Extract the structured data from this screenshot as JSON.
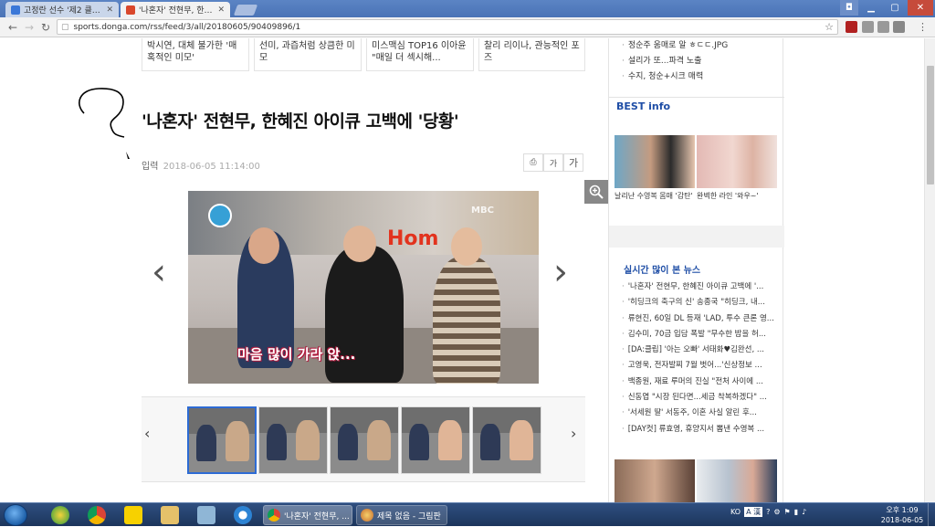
{
  "browser": {
    "tabs": [
      {
        "title": "고정란 선수 '제2 클라이",
        "active": false
      },
      {
        "title": "'나혼자' 전현무, 한혜진 아",
        "active": true
      }
    ],
    "url": "sports.donga.com/rss/feed/3/all/20180605/90409896/1",
    "back_icon": "back-arrow-icon",
    "forward_icon": "forward-arrow-icon",
    "reload_icon": "reload-icon"
  },
  "related": [
    "박시연, 대체 불가한 '매혹적인 미모'",
    "선미, 과즙처럼 상큼한 미모",
    "미스맥심 TOP16 이아윤 \"매일 더 섹시해...",
    "찰리 리이나, 관능적인 포즈"
  ],
  "article": {
    "headline": "'나혼자' 전현무, 한혜진 아이큐 고백에 '당황'",
    "date_label": "입력",
    "date": "2018-06-05 11:14:00",
    "print_icon": "print-icon",
    "font_small": "가",
    "font_large": "가"
  },
  "photo": {
    "subtitle": "마음 많이 가라 앉...",
    "sign": "Hom",
    "broadcaster": "MBC"
  },
  "sidebar": {
    "top_list": [
      "정순주 움매로 알 ㅎㄷㄷ.JPG",
      "설리가 또...파격 노출",
      "수지, 청순+시크 매력"
    ],
    "best_title": "BEST info",
    "best_captions": [
      "날리난 수영복 몸매 '감탄'",
      "완벽한 라인 '와우~'"
    ],
    "live_title": "실시간 많이 본 뉴스",
    "live_list": [
      "'나혼자' 전현무, 한혜진 아이큐 고백에 '...",
      "'히딩크의 축구의 신' 송종국 \"히딩크, 내...",
      "류현진, 60일 DL 등재 'LAD, 투수 큰론 영...",
      "김수미, 70금 입담 폭발 \"무수한 밤을 허...",
      "[DA:클립] '아는 오빠' 서태화♥김완선, ...",
      "고영욱, 전자발찌 7월 벗어...'신상정보 ...",
      "백종원, 재료 루머의 진실 \"전처 사이에 ...",
      "신동엽 \"시장 된다면...세금 착복하겠다\" ...",
      "'서세원 딸' 서동주, 이혼 사실 알린 후...",
      "[DAY컷] 류효영, 휴양지서 뽐낸 수영복 ..."
    ]
  },
  "taskbar": {
    "tasks": [
      "'나혼자' 전현무, ...",
      "제목 없음 - 그림판"
    ],
    "lang": "KO",
    "ime": "A 漢",
    "time": "오후 1:09",
    "date": "2018-06-05"
  }
}
